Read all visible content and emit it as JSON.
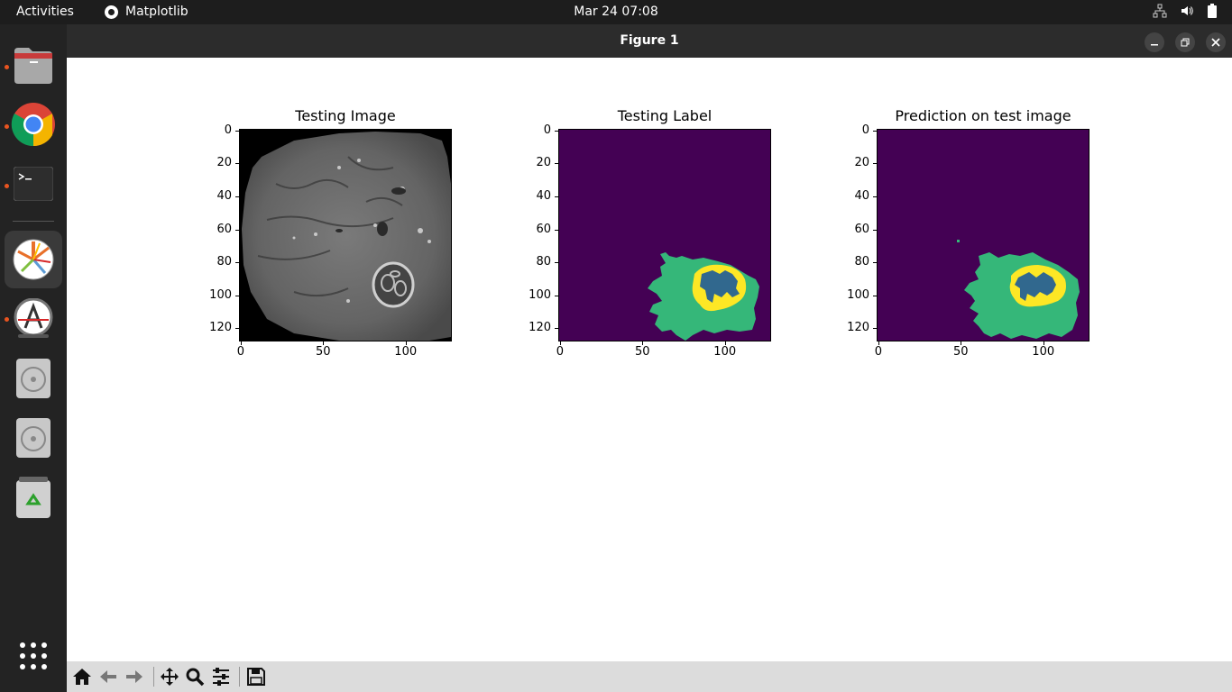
{
  "topbar": {
    "activities": "Activities",
    "app_name": "Matplotlib",
    "clock": "Mar 24  07:08"
  },
  "window": {
    "title": "Figure 1"
  },
  "dock": {
    "items": [
      "files",
      "chrome",
      "terminal",
      "matplotlib",
      "software-updater",
      "disc-1",
      "disc-2",
      "trash",
      "show-apps"
    ]
  },
  "figure": {
    "subplots": [
      {
        "title": "Testing Image",
        "xticks": [
          "0",
          "50",
          "100"
        ],
        "yticks": [
          "0",
          "20",
          "40",
          "60",
          "80",
          "100",
          "120"
        ],
        "kind": "grayscale-mri"
      },
      {
        "title": "Testing Label",
        "xticks": [
          "0",
          "50",
          "100"
        ],
        "yticks": [
          "0",
          "20",
          "40",
          "60",
          "80",
          "100",
          "120"
        ],
        "kind": "segmentation"
      },
      {
        "title": "Prediction on test image",
        "xticks": [
          "0",
          "50",
          "100"
        ],
        "yticks": [
          "0",
          "20",
          "40",
          "60",
          "80",
          "100",
          "120"
        ],
        "kind": "segmentation"
      }
    ],
    "colors": {
      "background_class": "#440154",
      "class_1": "#35b779",
      "class_2": "#31688e",
      "class_3": "#fde725"
    }
  },
  "toolbar": {
    "buttons": [
      "home",
      "back",
      "forward",
      "pan",
      "zoom",
      "configure-subplots",
      "save"
    ]
  }
}
